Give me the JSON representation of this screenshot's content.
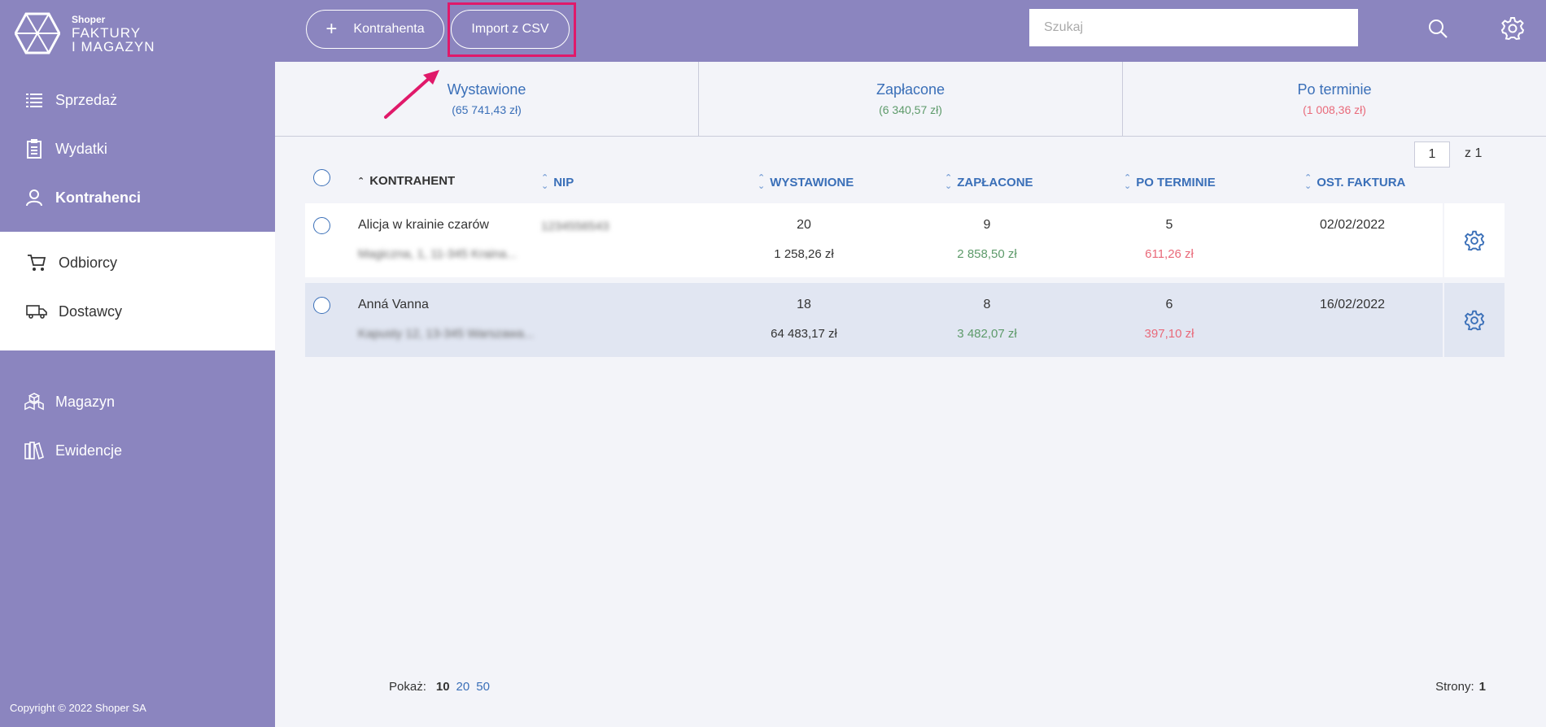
{
  "brand": {
    "small": "Shoper",
    "line1": "FAKTURY",
    "line2": "I MAGAZYN"
  },
  "sidebar": {
    "items": [
      {
        "label": "Sprzedaż",
        "icon": "list-icon"
      },
      {
        "label": "Wydatki",
        "icon": "clipboard-icon"
      },
      {
        "label": "Kontrahenci",
        "icon": "user-icon"
      }
    ],
    "subitems": [
      {
        "label": "Odbiorcy",
        "icon": "cart-icon"
      },
      {
        "label": "Dostawcy",
        "icon": "truck-icon"
      }
    ],
    "items2": [
      {
        "label": "Magazyn",
        "icon": "boxes-icon"
      },
      {
        "label": "Ewidencje",
        "icon": "books-icon"
      }
    ],
    "copyright": "Copyright © 2022 Shoper SA"
  },
  "toolbar": {
    "add_label": "Kontrahenta",
    "import_label": "Import z CSV",
    "search_placeholder": "Szukaj"
  },
  "summary": [
    {
      "label": "Wystawione",
      "value": "(65 741,43 zł)"
    },
    {
      "label": "Zapłacone",
      "value": "(6 340,57 zł)"
    },
    {
      "label": "Po terminie",
      "value": "(1 008,36 zł)"
    }
  ],
  "pager": {
    "current": "1",
    "total": "z 1"
  },
  "table": {
    "headers": {
      "kontrahent": "KONTRAHENT",
      "nip": "NIP",
      "wystawione": "WYSTAWIONE",
      "zaplacone": "ZAPŁACONE",
      "po_terminie": "PO TERMINIE",
      "ost_faktura": "OST. FAKTURA"
    },
    "rows": [
      {
        "name": "Alicja w krainie czarów",
        "address": "Magiczna, 1, 11-345 Kraina...",
        "nip": "1234556543",
        "issued_count": "20",
        "issued_amount": "1 258,26 zł",
        "paid_count": "9",
        "paid_amount": "2 858,50 zł",
        "overdue_count": "5",
        "overdue_amount": "611,26 zł",
        "last_invoice": "02/02/2022"
      },
      {
        "name": "Anná Vanna",
        "address": "Kapusty 12, 13-345 Warszawa...",
        "nip": "",
        "issued_count": "18",
        "issued_amount": "64 483,17 zł",
        "paid_count": "8",
        "paid_amount": "3 482,07 zł",
        "overdue_count": "6",
        "overdue_amount": "397,10 zł",
        "last_invoice": "16/02/2022"
      }
    ]
  },
  "footer": {
    "show_label": "Pokaż:",
    "options": [
      "10",
      "20",
      "50"
    ],
    "pages_label": "Strony:",
    "pages_value": "1"
  },
  "colors": {
    "sidebar": "#8b85bf",
    "link_blue": "#3a6fb8",
    "paid_green": "#5d9a6a",
    "overdue_red": "#e96a7a",
    "highlight": "#e0196a"
  }
}
